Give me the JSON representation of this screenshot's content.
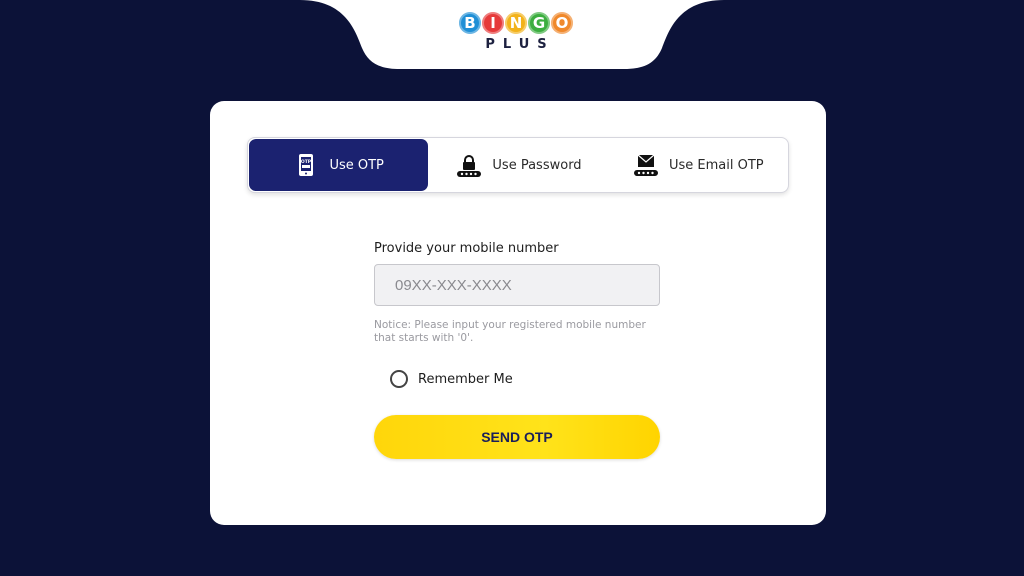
{
  "logo": {
    "letters": [
      {
        "char": "B",
        "color": "#1f8fd6"
      },
      {
        "char": "I",
        "color": "#e63a3a"
      },
      {
        "char": "N",
        "color": "#f2b21a"
      },
      {
        "char": "G",
        "color": "#3cae3f"
      },
      {
        "char": "O",
        "color": "#f0882a"
      }
    ],
    "sub": "PLUS"
  },
  "tabs": [
    {
      "label": "Use OTP",
      "icon": "otp-phone-icon",
      "active": true
    },
    {
      "label": "Use Password",
      "icon": "lock-icon",
      "active": false
    },
    {
      "label": "Use Email OTP",
      "icon": "envelope-icon",
      "active": false
    }
  ],
  "form": {
    "mobile_label": "Provide your mobile number",
    "mobile_placeholder": "09XX-XXX-XXXX",
    "mobile_value": "",
    "notice": "Notice: Please input your registered mobile number that starts with '0'.",
    "remember_label": "Remember Me",
    "remember_checked": false,
    "send_label": "SEND OTP"
  },
  "colors": {
    "background": "#0c1238",
    "active_tab": "#1b2270",
    "button": "#ffdd10"
  }
}
